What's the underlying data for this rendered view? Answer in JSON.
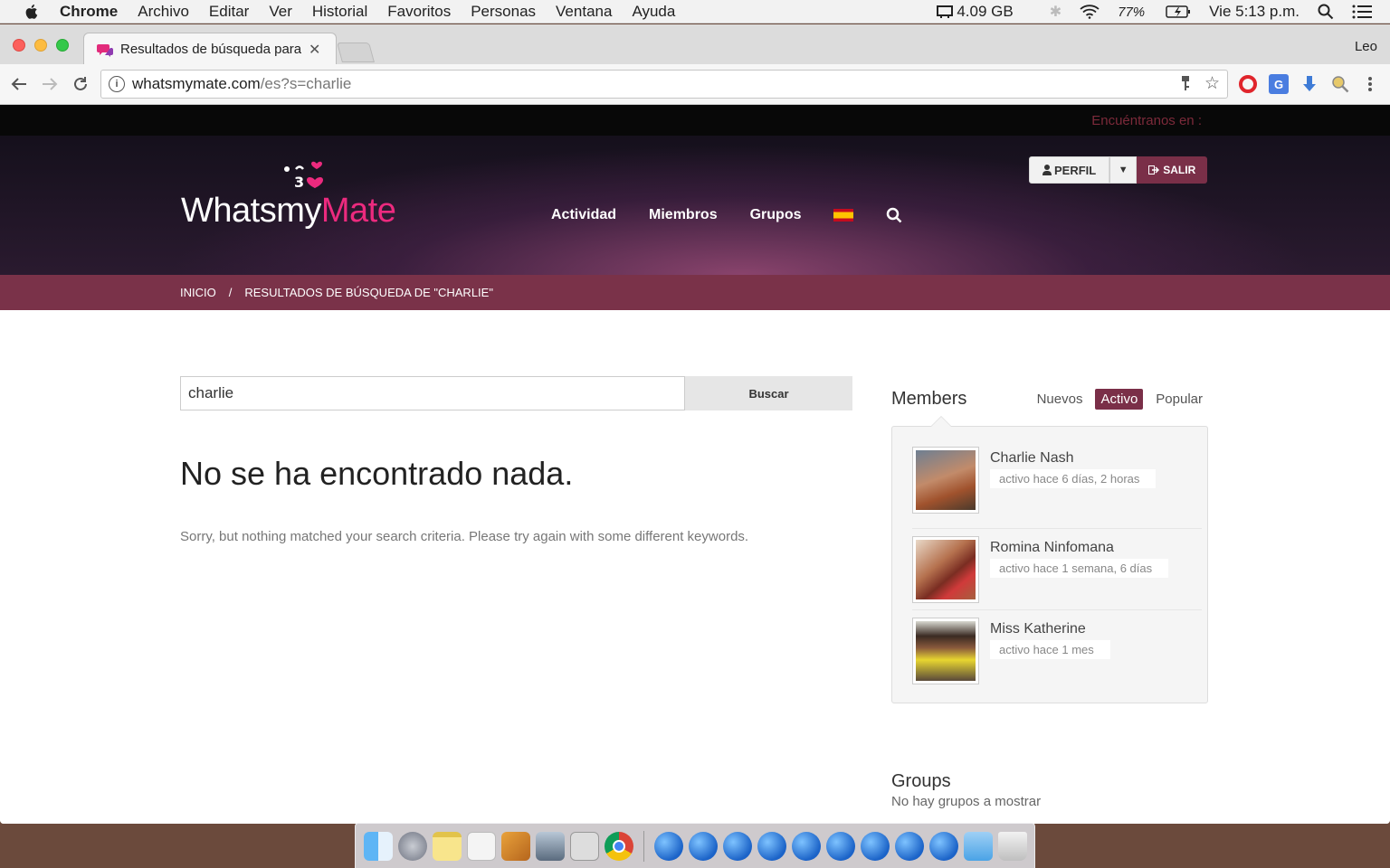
{
  "menubar": {
    "app": "Chrome",
    "items": [
      "Archivo",
      "Editar",
      "Ver",
      "Historial",
      "Favoritos",
      "Personas",
      "Ventana",
      "Ayuda"
    ],
    "memory": "4.09 GB",
    "battery": "77%",
    "clock": "Vie 5:13 p.m."
  },
  "browser": {
    "tab_title": "Resultados de búsqueda para",
    "profile": "Leo",
    "url_host": "whatsmymate.com",
    "url_path": "/es?s=charlie"
  },
  "site": {
    "find_us": "Encuéntranos en :",
    "logo_a": "Whatsmy",
    "logo_b": "Mate",
    "nav": [
      "Actividad",
      "Miembros",
      "Grupos"
    ],
    "perfil": "PERFIL",
    "salir": "SALIR",
    "breadcrumb": {
      "home": "INICIO",
      "sep": "/",
      "current": "RESULTADOS DE BÚSQUEDA DE \"CHARLIE\""
    },
    "search": {
      "value": "charlie",
      "button": "Buscar"
    },
    "noresult_title": "No se ha encontrado nada.",
    "noresult_msg": "Sorry, but nothing matched your search criteria. Please try again with some different keywords."
  },
  "sidebar": {
    "members_title": "Members",
    "filters": [
      "Nuevos",
      "Activo",
      "Popular"
    ],
    "active_filter": "Activo",
    "members": [
      {
        "name": "Charlie Nash",
        "active": "activo hace 6 días, 2 horas"
      },
      {
        "name": "Romina Ninfomana",
        "active": "activo hace 1 semana, 6 días"
      },
      {
        "name": "Miss Katherine",
        "active": "activo hace 1 mes"
      }
    ],
    "groups_title": "Groups",
    "groups_empty": "No hay grupos a mostrar"
  }
}
